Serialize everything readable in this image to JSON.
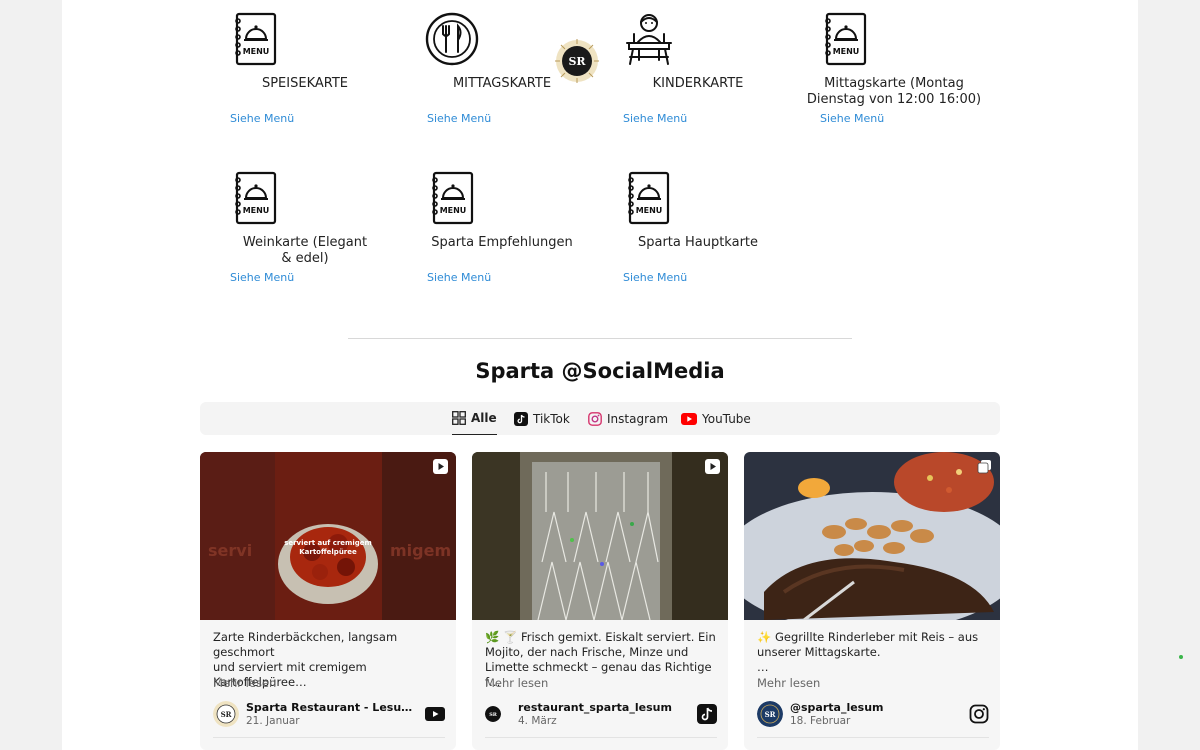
{
  "menus": [
    {
      "title": "SPEISEKARTE",
      "icon": "menu-book-icon",
      "link": "Siehe Menü"
    },
    {
      "title": "MITTAGSKARTE",
      "icon": "plate-cutlery-icon",
      "link": "Siehe Menü"
    },
    {
      "title": "KINDERKARTE",
      "icon": "child-table-icon",
      "link": "Siehe Menü"
    },
    {
      "title": "Mittagskarte (Montag Dienstag von 12:00 16:00)",
      "icon": "menu-book-icon",
      "link": "Siehe Menü"
    },
    {
      "title": "Weinkarte (Elegant & edel)",
      "icon": "menu-book-icon",
      "link": "Siehe Menü"
    },
    {
      "title": "Sparta Empfehlungen",
      "icon": "menu-book-icon",
      "link": "Siehe Menü"
    },
    {
      "title": "Sparta Hauptkarte",
      "icon": "menu-book-icon",
      "link": "Siehe Menü"
    }
  ],
  "logo_text": "SR",
  "social": {
    "title": "Sparta @SocialMedia",
    "tabs": [
      {
        "label": "Alle",
        "icon": "grid-icon"
      },
      {
        "label": "TikTok",
        "icon": "tiktok-icon"
      },
      {
        "label": "Instagram",
        "icon": "instagram-icon"
      },
      {
        "label": "YouTube",
        "icon": "youtube-icon"
      }
    ],
    "active_tab": "Alle",
    "posts": [
      {
        "caption": "Zarte Rinderbäckchen, langsam geschmort\nund serviert mit cremigem Kartoffelpüree…",
        "image_text": "serviert auf cremigem Kartoffelpüree",
        "more": "Mehr lesen",
        "author": "Sparta Restaurant - Lesum Bre…",
        "date": "21. Januar",
        "platform": "youtube",
        "avatar_text": "SR"
      },
      {
        "caption": "🌿 🍸 Frisch gemixt. Eiskalt serviert. Ein Mojito, der nach Frische, Minze und Limette schmeckt – genau das Richtige f…",
        "more": "Mehr lesen",
        "author": "restaurant_sparta_lesum",
        "date": "4. März",
        "platform": "tiktok",
        "avatar_text": "SR"
      },
      {
        "caption": "✨ Gegrillte Rinderleber mit Reis – aus unserer Mittagskarte.\n…",
        "more": "Mehr lesen",
        "author": "@sparta_lesum",
        "date": "18. Februar",
        "platform": "instagram",
        "avatar_text": "SR"
      }
    ]
  }
}
